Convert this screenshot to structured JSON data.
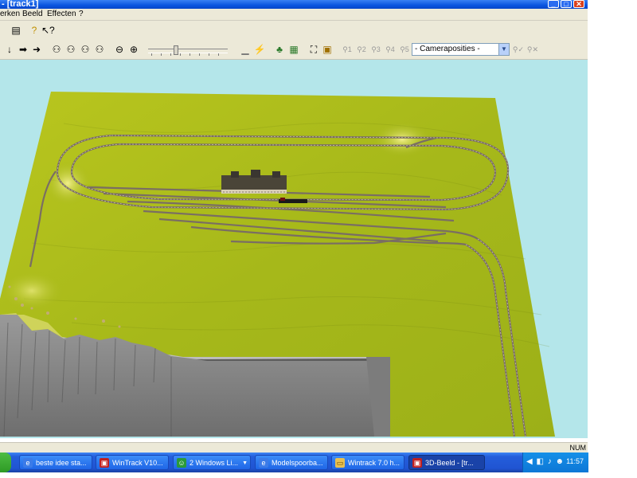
{
  "window": {
    "title": "- [track1]"
  },
  "menu": {
    "items": [
      "erken",
      "Beeld",
      "Effecten",
      "?"
    ]
  },
  "toolbar": {
    "row1": [
      "clipboard-icon",
      "help-icon",
      "context-help-icon"
    ],
    "row2_nav": [
      "arrow-down-icon",
      "arrow-right-icon",
      "arrow-right-2-icon"
    ],
    "row2_view": [
      "walk-view-icon",
      "walk-view-2-icon",
      "walk-view-3-icon",
      "walk-view-4-icon"
    ],
    "zoom": [
      "zoom-out-icon",
      "zoom-in-icon"
    ],
    "scene_tools": [
      "ground-icon",
      "signal-icon",
      "trees-icon",
      "grid-icon",
      "fit-view-icon",
      "camera-icon"
    ],
    "camera_buttons": [
      "1",
      "2",
      "3",
      "4",
      "5"
    ],
    "camera_select": "- Cameraposities -",
    "trailing": [
      "camera-add-icon",
      "camera-delete-icon"
    ]
  },
  "status": {
    "num": "NUM"
  },
  "taskbar": {
    "tasks": [
      {
        "label": "beste idee sta...",
        "icon": "ie-icon"
      },
      {
        "label": "WinTrack V10...",
        "icon": "wintrack-icon"
      },
      {
        "label": "2 Windows Li...",
        "icon": "windows-live-icon"
      },
      {
        "label": "Modelspoorba...",
        "icon": "ie-icon"
      },
      {
        "label": "Wintrack 7.0 h...",
        "icon": "folder-icon"
      },
      {
        "label": "3D-Beeld - [tr...",
        "icon": "train-icon"
      }
    ],
    "clock": "11:57"
  },
  "colors": {
    "sky": "#b4e6ea",
    "grass": "#a6b81a",
    "cliff": "#8a8a8a",
    "track": "#7a6e63",
    "titlebar": "#0a55e0",
    "taskbar": "#245edb"
  }
}
